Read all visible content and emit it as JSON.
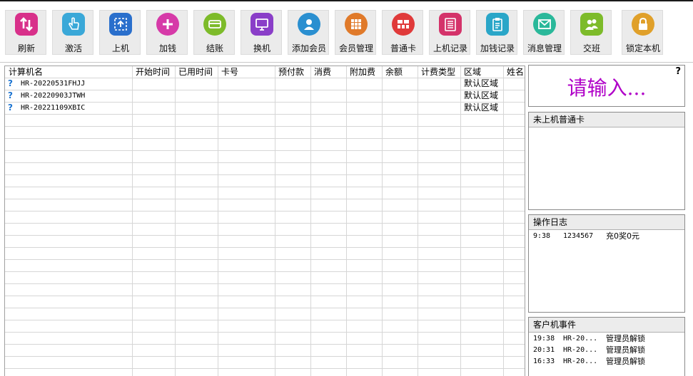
{
  "toolbar": {
    "buttons": [
      {
        "label": "刷新",
        "icon": "refresh-arrows-icon",
        "color": "#d8308a"
      },
      {
        "label": "激活",
        "icon": "hand-pointer-icon",
        "color": "#3aa8d8"
      },
      {
        "label": "上机",
        "icon": "upload-frame-icon",
        "color": "#2a6fcc"
      },
      {
        "label": "加钱",
        "icon": "plus-icon",
        "color": "#d63aa8"
      },
      {
        "label": "结账",
        "icon": "card-checkout-icon",
        "color": "#7dbb2a"
      },
      {
        "label": "换机",
        "icon": "monitor-icon",
        "color": "#8a3ec8"
      },
      {
        "label": "添加会员",
        "icon": "user-add-icon",
        "color": "#2a8fd0"
      },
      {
        "label": "会员管理",
        "icon": "grid-icon",
        "color": "#e07a2a"
      },
      {
        "label": "普通卡",
        "icon": "card-icon",
        "color": "#e03a3a"
      },
      {
        "label": "上机记录",
        "icon": "list-record-icon",
        "color": "#d4336a"
      },
      {
        "label": "加钱记录",
        "icon": "clipboard-icon",
        "color": "#2aa6c8"
      },
      {
        "label": "消息管理",
        "icon": "envelope-icon",
        "color": "#2ab89a"
      },
      {
        "label": "交班",
        "icon": "users-handover-icon",
        "color": "#7dbb2a"
      },
      {
        "label": "锁定本机",
        "icon": "lock-icon",
        "color": "#e0a02a"
      }
    ]
  },
  "grid": {
    "columns": [
      "计算机名",
      "开始时间",
      "已用时间",
      "卡号",
      "预付款",
      "消费",
      "附加费",
      "余额",
      "计费类型",
      "区域",
      "姓名"
    ],
    "rows": [
      {
        "status_icon": "?",
        "name": "HR-20220531FHJJ",
        "start": "",
        "used": "",
        "card": "",
        "prepay": "",
        "spend": "",
        "extra": "",
        "balance": "",
        "billing": "",
        "zone": "默认区域",
        "person": ""
      },
      {
        "status_icon": "?",
        "name": "HR-20220903JTWH",
        "start": "",
        "used": "",
        "card": "",
        "prepay": "",
        "spend": "",
        "extra": "",
        "balance": "",
        "billing": "",
        "zone": "默认区域",
        "person": ""
      },
      {
        "status_icon": "?",
        "name": "HR-20221109XBIC",
        "start": "",
        "used": "",
        "card": "",
        "prepay": "",
        "spend": "",
        "extra": "",
        "balance": "",
        "billing": "",
        "zone": "默认区域",
        "person": ""
      }
    ]
  },
  "input_panel": {
    "placeholder": "请输入...",
    "help": "?"
  },
  "offline_cards": {
    "title": "未上机普通卡",
    "items": []
  },
  "op_log": {
    "title": "操作日志",
    "entries": [
      {
        "time": "9:38",
        "id": "1234567",
        "text": "充0奖0元"
      }
    ]
  },
  "client_events": {
    "title": "客户机事件",
    "entries": [
      {
        "time": "19:38",
        "machine": "HR-20...",
        "event": "管理员解锁"
      },
      {
        "time": "20:31",
        "machine": "HR-20...",
        "event": "管理员解锁"
      },
      {
        "time": "16:33",
        "machine": "HR-20...",
        "event": "管理员解锁"
      }
    ]
  }
}
